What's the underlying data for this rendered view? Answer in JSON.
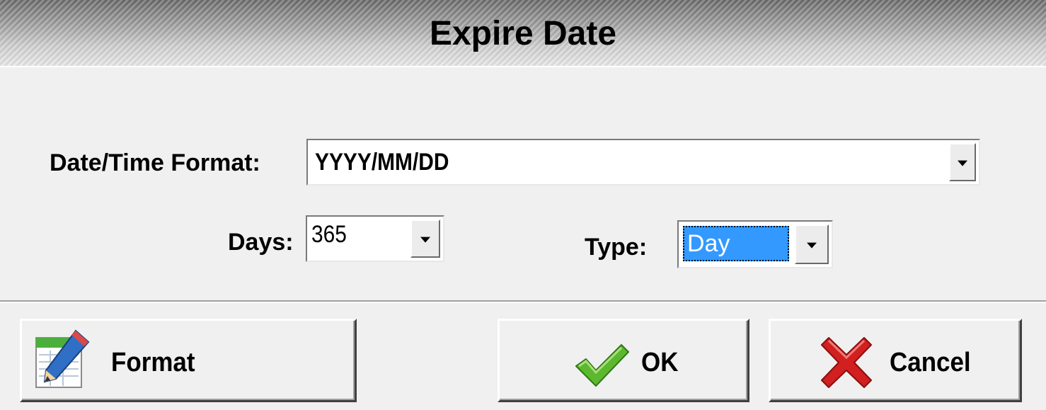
{
  "dialog": {
    "title": "Expire Date"
  },
  "format_field": {
    "label": "Date/Time Format:",
    "value": "YYYY/MM/DD"
  },
  "days_field": {
    "label": "Days:",
    "value": "365"
  },
  "type_field": {
    "label": "Type:",
    "value": "Day"
  },
  "buttons": {
    "format": "Format",
    "ok": "OK",
    "cancel": "Cancel"
  },
  "colors": {
    "selection": "#3399ff",
    "ok_check": "#5cb82e",
    "cancel_x": "#d21f1f"
  },
  "icons": {
    "format": "edit-pencil-icon",
    "ok": "checkmark-icon",
    "cancel": "red-x-icon"
  }
}
